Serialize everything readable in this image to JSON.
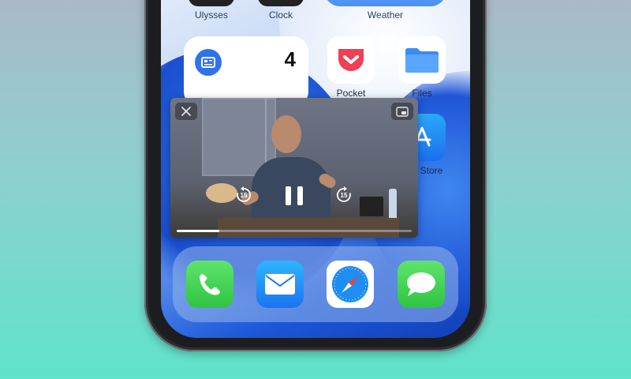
{
  "home_screen": {
    "top_row": [
      {
        "label": "Ulysses"
      },
      {
        "label": "Clock"
      },
      {
        "label": "Weather"
      }
    ],
    "widget": {
      "icon": "news-icon",
      "count": "4"
    },
    "apps": [
      {
        "label": "Pocket",
        "icon": "pocket-icon",
        "color": "#ef4056"
      },
      {
        "label": "Files",
        "icon": "folder-icon",
        "color": "#3b8bf5"
      },
      {
        "label": "Store",
        "icon": "app-store-icon",
        "color": "#1a8ef0"
      }
    ]
  },
  "pip_player": {
    "close_icon": "close-icon",
    "expand_icon": "pip-expand-icon",
    "skip_back_seconds": "15",
    "skip_forward_seconds": "15",
    "state": "playing",
    "progress_fraction": 0.18
  },
  "dock": {
    "apps": [
      {
        "name": "phone-app",
        "icon": "phone-icon",
        "color": "#3dd24e"
      },
      {
        "name": "mail-app",
        "icon": "mail-icon",
        "color": "#1e8cf2"
      },
      {
        "name": "safari-app",
        "icon": "compass-icon",
        "color": "#ffffff"
      },
      {
        "name": "messages-app",
        "icon": "message-icon",
        "color": "#3dd24e"
      }
    ]
  }
}
